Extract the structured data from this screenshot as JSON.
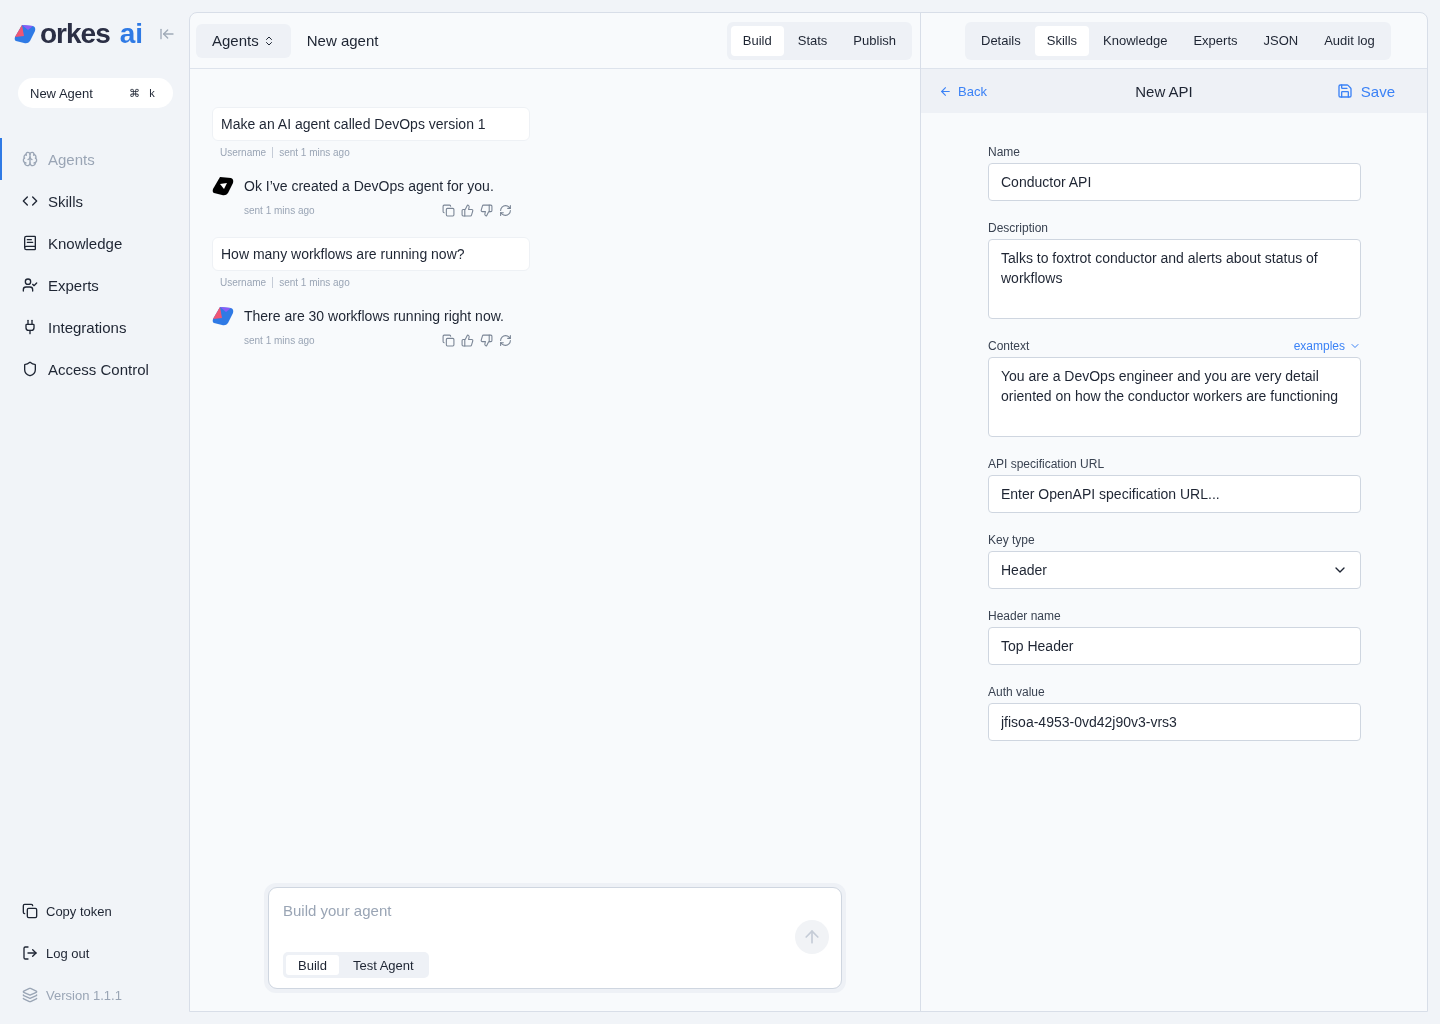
{
  "brand": {
    "name": "orkes",
    "suffix": "ai"
  },
  "new_agent": {
    "label": "New Agent",
    "keys": [
      "⌘",
      "k"
    ]
  },
  "nav": [
    {
      "label": "Agents",
      "selected": true
    },
    {
      "label": "Skills",
      "selected": false
    },
    {
      "label": "Knowledge",
      "selected": false
    },
    {
      "label": "Experts",
      "selected": false
    },
    {
      "label": "Integrations",
      "selected": false
    },
    {
      "label": "Access Control",
      "selected": false
    }
  ],
  "footer": [
    {
      "label": "Copy token",
      "disabled": false
    },
    {
      "label": "Log out",
      "disabled": false
    },
    {
      "label": "Version 1.1.1",
      "disabled": true
    }
  ],
  "header": {
    "dropdown": "Agents",
    "title": "New agent",
    "tabs": [
      {
        "label": "Build",
        "selected": true
      },
      {
        "label": "Stats",
        "selected": false
      },
      {
        "label": "Publish",
        "selected": false
      }
    ]
  },
  "messages": [
    {
      "kind": "user",
      "text": "Make an AI agent called DevOps version 1",
      "author": "Username",
      "time": "sent 1 mins ago"
    },
    {
      "kind": "agent",
      "text": "Ok I’ve created a DevOps agent for you.",
      "time": "sent 1 mins ago"
    },
    {
      "kind": "user",
      "text": "How many workflows are running now?",
      "author": "Username",
      "time": "sent 1 mins ago"
    },
    {
      "kind": "agent",
      "text": "There are 30 workflows running right now.",
      "time": "sent 1 mins ago"
    }
  ],
  "composer": {
    "placeholder": "Build your agent",
    "modes": [
      {
        "label": "Build",
        "selected": true
      },
      {
        "label": "Test Agent",
        "selected": false
      }
    ]
  },
  "right_tabs": [
    {
      "label": "Details",
      "selected": false
    },
    {
      "label": "Skills",
      "selected": true
    },
    {
      "label": "Knowledge",
      "selected": false
    },
    {
      "label": "Experts",
      "selected": false
    },
    {
      "label": "JSON",
      "selected": false
    },
    {
      "label": "Audit log",
      "selected": false
    }
  ],
  "form_header": {
    "back": "Back",
    "title": "New API",
    "save": "Save"
  },
  "fields": [
    {
      "kind": "input",
      "label": "Name",
      "value": "Conductor API"
    },
    {
      "kind": "textarea",
      "label": "Description",
      "value": "Talks to foxtrot conductor and alerts about status of workflows"
    },
    {
      "kind": "textarea",
      "label": "Context",
      "link": "examples",
      "value": "You are a DevOps engineer and you are very detail oriented on how the conductor workers are functioning"
    },
    {
      "kind": "input",
      "label": "API specification URL",
      "placeholder": "Enter OpenAPI specification URL..."
    },
    {
      "kind": "select",
      "label": "Key type",
      "value": "Header"
    },
    {
      "kind": "input",
      "label": "Header name",
      "value": "Top Header"
    },
    {
      "kind": "input",
      "label": "Auth value",
      "value": "jfisoa-4953-0vd42j90v3-vrs3"
    }
  ]
}
